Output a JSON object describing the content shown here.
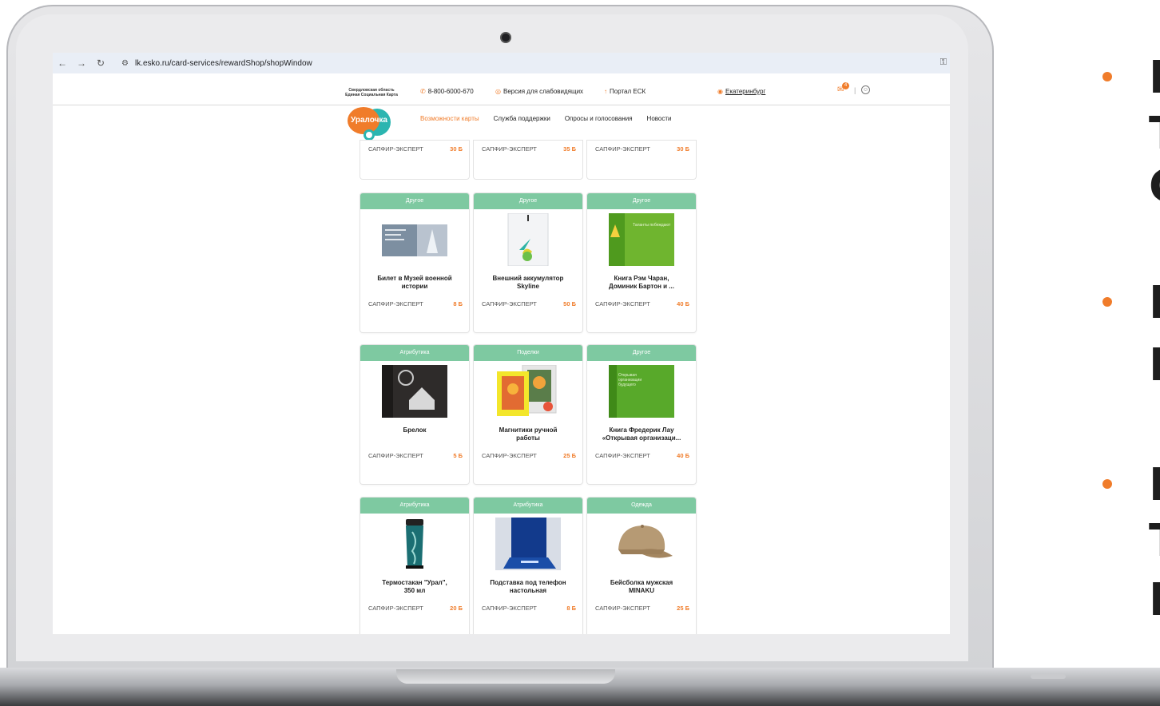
{
  "browser": {
    "url": "lk.esko.ru/card-services/rewardShop/shopWindow",
    "back_icon": "arrow-left-icon",
    "forward_icon": "arrow-right-icon",
    "reload_icon": "reload-icon"
  },
  "header": {
    "region_line1": "Свердловская область",
    "region_line2": "Единая Социальная Карта",
    "phone": "8-800-6000-670",
    "accessibility": "Версия для слабовидящих",
    "portal": "Портал ЕСК",
    "city": "Екатеринбург",
    "notifications_count": "4",
    "logo_text": "Уралочка"
  },
  "nav": {
    "items": [
      "Возможности карты",
      "Служба поддержки",
      "Опросы и голосования",
      "Новости"
    ]
  },
  "top_row": [
    {
      "level": "САПФИР-ЭКСПЕРТ",
      "price": "30 Б"
    },
    {
      "level": "САПФИР-ЭКСПЕРТ",
      "price": "35 Б"
    },
    {
      "level": "САПФИР-ЭКСПЕРТ",
      "price": "30 Б"
    }
  ],
  "products": [
    {
      "category": "Другое",
      "title1": "Билет в Музей военной",
      "title2": "истории",
      "level": "САПФИР-ЭКСПЕРТ",
      "price": "8 Б"
    },
    {
      "category": "Другое",
      "title1": "Внешний аккумулятор",
      "title2": "Skyline",
      "level": "САПФИР-ЭКСПЕРТ",
      "price": "50 Б"
    },
    {
      "category": "Другое",
      "title1": "Книга Рэм Чаран,",
      "title2": "Доминик Бартон и ...",
      "level": "САПФИР-ЭКСПЕРТ",
      "price": "40 Б",
      "img_caption": "Таланты побеждают"
    },
    {
      "category": "Атрибутика",
      "title1": "Брелок",
      "title2": "",
      "level": "САПФИР-ЭКСПЕРТ",
      "price": "5 Б"
    },
    {
      "category": "Поделки",
      "title1": "Магнитики ручной",
      "title2": "работы",
      "level": "САПФИР-ЭКСПЕРТ",
      "price": "25 Б"
    },
    {
      "category": "Другое",
      "title1": "Книга Фредерик Лау",
      "title2": "«Открывая организаци...",
      "level": "САПФИР-ЭКСПЕРТ",
      "price": "40 Б",
      "img_caption": "Открывая организации будущего"
    },
    {
      "category": "Атрибутика",
      "title1": "Термостакан \"Урал\",",
      "title2": "350 мл",
      "level": "САПФИР-ЭКСПЕРТ",
      "price": "20 Б"
    },
    {
      "category": "Атрибутика",
      "title1": "Подставка под телефон",
      "title2": "настольная",
      "level": "САПФИР-ЭКСПЕРТ",
      "price": "8 Б"
    },
    {
      "category": "Одежда",
      "title1": "Бейсболка мужская",
      "title2": "MINAKU",
      "level": "САПФИР-ЭКСПЕРТ",
      "price": "25 Б"
    }
  ],
  "slide_letters": [
    "Е",
    "Т",
    "С",
    "И",
    "Н",
    "П",
    "Т",
    "П"
  ],
  "colors": {
    "accent": "#f07c2a",
    "category_bar": "#7ec9a1",
    "teal": "#2bb5b0"
  }
}
